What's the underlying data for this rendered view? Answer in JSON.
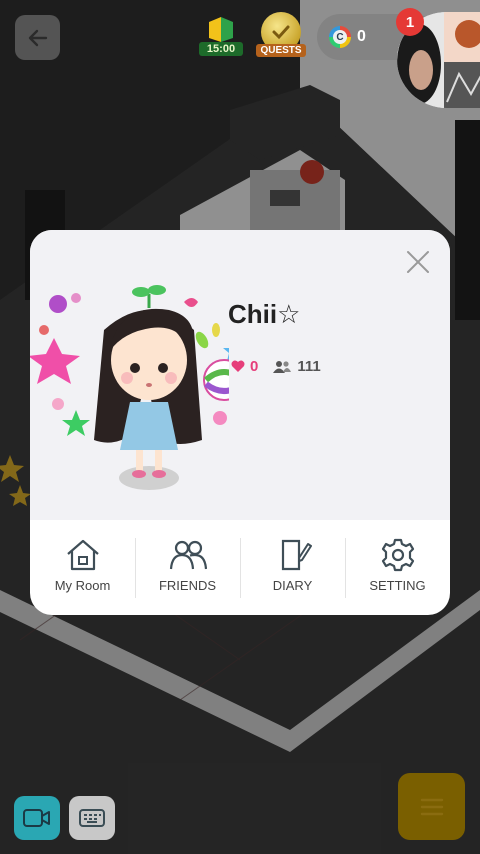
{
  "hud": {
    "timer": "15:00",
    "quests_label": "QUESTS",
    "coins": "0",
    "notifications": "1"
  },
  "profile": {
    "name": "Chii☆",
    "likes": "0",
    "friends_count": "111"
  },
  "actions": [
    {
      "label": "My Room",
      "icon": "house-icon"
    },
    {
      "label": "FRIENDS",
      "icon": "friends-icon"
    },
    {
      "label": "DIARY",
      "icon": "diary-icon"
    },
    {
      "label": "SETTING",
      "icon": "gear-icon"
    }
  ],
  "colors": {
    "accent_pink": "#e63e7a",
    "menu_button": "#7a5f00",
    "video_button": "#2aa7b3",
    "popup_bg": "#f2f2f5"
  }
}
